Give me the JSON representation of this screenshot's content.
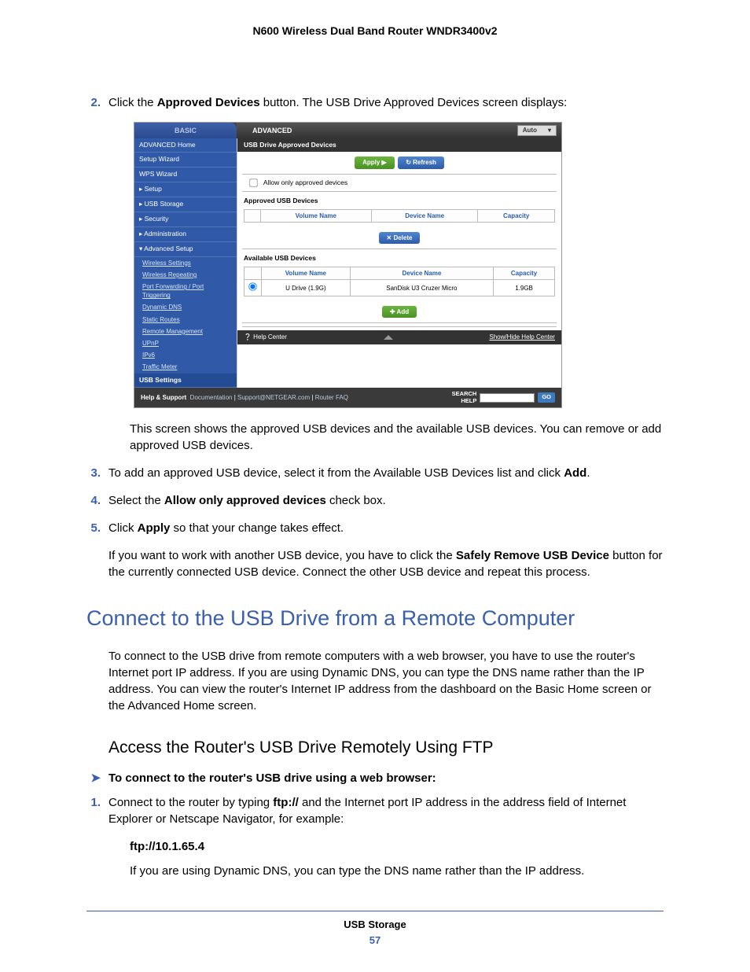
{
  "doc": {
    "header": "N600 Wireless Dual Band Router WNDR3400v2",
    "footer_title": "USB Storage",
    "footer_page": "57"
  },
  "steps": {
    "s2_a": "Click the ",
    "s2_b": "Approved Devices",
    "s2_c": " button. The USB Drive Approved Devices screen displays:",
    "s2_after": "This screen shows the approved USB devices and the available USB devices. You can remove or add approved USB devices.",
    "s3_a": "To add an approved USB device, select it from the Available USB Devices list and click ",
    "s3_b": "Add",
    "s3_c": ".",
    "s4_a": "Select the ",
    "s4_b": "Allow only approved devices",
    "s4_c": " check box.",
    "s5_a": "Click ",
    "s5_b": "Apply",
    "s5_c": " so that your change takes effect."
  },
  "after_steps_a": "If you want to work with another USB device, you have to click the ",
  "after_steps_b": "Safely Remove USB Device",
  "after_steps_c": " button for the currently connected USB device. Connect the other USB device and repeat this process.",
  "h1": "Connect to the USB Drive from a Remote Computer",
  "h1_para": "To connect to the USB drive from remote computers with a web browser, you have to use the router's Internet port IP address. If you are using Dynamic DNS, you can type the DNS name rather than the IP address. You can view the router's Internet IP address from the dashboard on the Basic Home screen or the Advanced Home screen.",
  "h2": "Access the Router's USB Drive Remotely Using FTP",
  "proc_title": "To connect to the router's USB drive using a web browser:",
  "p1_a": "Connect to the router by typing ",
  "p1_b": "ftp://",
  "p1_c": " and the Internet port IP address in the address field of Internet Explorer or Netscape Navigator, for example:",
  "ftp_example": "ftp://10.1.65.4",
  "p1_after": "If you are using Dynamic DNS, you can type the DNS name rather than the IP address.",
  "ss": {
    "tab_basic": "BASIC",
    "tab_advanced": "ADVANCED",
    "auto": "Auto",
    "side": {
      "home": "ADVANCED Home",
      "setup_wiz": "Setup Wizard",
      "wps_wiz": "WPS Wizard",
      "setup": "▸ Setup",
      "usb": "▸ USB Storage",
      "security": "▸ Security",
      "admin": "▸ Administration",
      "adv": "▾ Advanced Setup",
      "sub_ws": "Wireless Settings",
      "sub_wr": "Wireless Repeating",
      "sub_pf": "Port Forwarding / Port Triggering",
      "sub_ddns": "Dynamic DNS",
      "sub_sr": "Static Routes",
      "sub_rm": "Remote Management",
      "sub_upnp": "UPnP",
      "sub_ipv6": "IPv6",
      "sub_tm": "Traffic Meter",
      "sub_usb": "USB Settings"
    },
    "panel_title": "USB Drive Approved Devices",
    "btn_apply": "Apply ▶",
    "btn_refresh": "↻ Refresh",
    "chk_label": "Allow only approved devices",
    "approved_label": "Approved USB Devices",
    "available_label": "Available USB Devices",
    "th_vol": "Volume Name",
    "th_dev": "Device Name",
    "th_cap": "Capacity",
    "btn_delete": "✕ Delete",
    "btn_add": "✚ Add",
    "row_vol": "U Drive (1.9G)",
    "row_dev": "SanDisk U3 Cruzer Micro",
    "row_cap": "1.9GB",
    "help_center": "❔ Help Center",
    "help_toggle": "Show/Hide Help Center",
    "footer_hs": "Help & Support",
    "footer_doc": "Documentation",
    "footer_sup": "Support@NETGEAR.com",
    "footer_faq": "Router FAQ",
    "search_lbl": "SEARCH HELP",
    "go": "GO"
  }
}
